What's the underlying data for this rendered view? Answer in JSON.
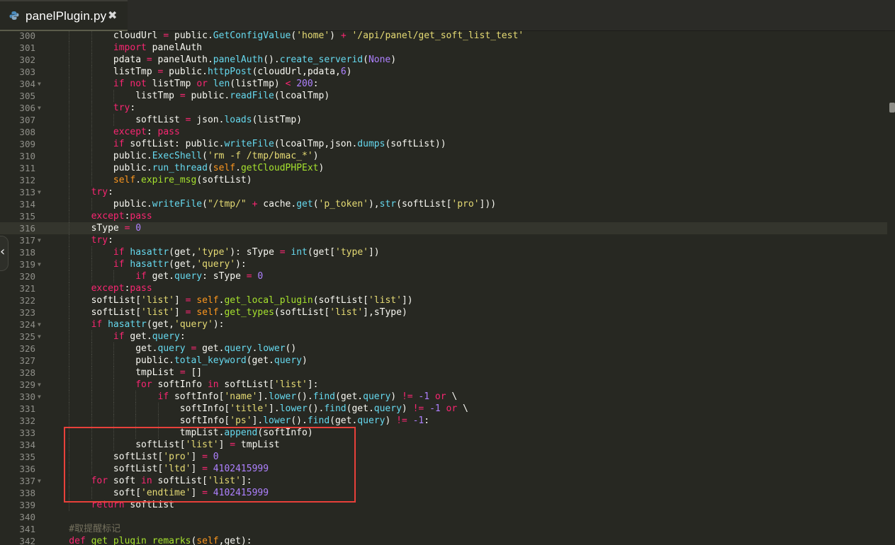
{
  "tab": {
    "title": "panelPlugin.py",
    "close_glyph": "✖",
    "icon": "python-icon"
  },
  "handle": {
    "glyph": "‹",
    "icon": "chevron-left-icon"
  },
  "colors": {
    "background": "#272822",
    "highlight_box": "#e8403a",
    "keyword": "#f92672",
    "builtin": "#66d9ef",
    "string": "#e6db74",
    "number": "#ae81ff"
  },
  "lines": [
    {
      "n": "300",
      "i": 3,
      "t": [
        [
          "",
          "cloudUrl "
        ],
        [
          "k",
          "="
        ],
        [
          "",
          " public."
        ],
        [
          "f",
          "GetConfigValue"
        ],
        [
          "",
          "("
        ],
        [
          "s",
          "'home'"
        ],
        [
          "",
          ") "
        ],
        [
          "k",
          "+"
        ],
        [
          "",
          " "
        ],
        [
          "s",
          "'/api/panel/get_soft_list_test'"
        ]
      ]
    },
    {
      "n": "301",
      "i": 3,
      "t": [
        [
          "k",
          "import"
        ],
        [
          "",
          " panelAuth"
        ]
      ]
    },
    {
      "n": "302",
      "i": 3,
      "t": [
        [
          "",
          "pdata "
        ],
        [
          "k",
          "="
        ],
        [
          "",
          " panelAuth."
        ],
        [
          "f",
          "panelAuth"
        ],
        [
          "",
          "()."
        ],
        [
          "f",
          "create_serverid"
        ],
        [
          "",
          "("
        ],
        [
          "n",
          "None"
        ],
        [
          "",
          ")"
        ]
      ]
    },
    {
      "n": "303",
      "i": 3,
      "t": [
        [
          "",
          "listTmp "
        ],
        [
          "k",
          "="
        ],
        [
          "",
          " public."
        ],
        [
          "f",
          "httpPost"
        ],
        [
          "",
          "(cloudUrl,pdata,"
        ],
        [
          "n",
          "6"
        ],
        [
          "",
          ")"
        ]
      ]
    },
    {
      "n": "304",
      "i": 3,
      "fold": true,
      "t": [
        [
          "k",
          "if"
        ],
        [
          "",
          " "
        ],
        [
          "k",
          "not"
        ],
        [
          "",
          " listTmp "
        ],
        [
          "k",
          "or"
        ],
        [
          "",
          " "
        ],
        [
          "f",
          "len"
        ],
        [
          "",
          "(listTmp) "
        ],
        [
          "k",
          "<"
        ],
        [
          "",
          " "
        ],
        [
          "n",
          "200"
        ],
        [
          "",
          ":"
        ]
      ]
    },
    {
      "n": "305",
      "i": 4,
      "t": [
        [
          "",
          "listTmp "
        ],
        [
          "k",
          "="
        ],
        [
          "",
          " public."
        ],
        [
          "f",
          "readFile"
        ],
        [
          "",
          "(lcoalTmp)"
        ]
      ]
    },
    {
      "n": "306",
      "i": 3,
      "fold": true,
      "t": [
        [
          "k",
          "try"
        ],
        [
          "",
          ":"
        ]
      ]
    },
    {
      "n": "307",
      "i": 4,
      "t": [
        [
          "",
          "softList "
        ],
        [
          "k",
          "="
        ],
        [
          "",
          " json."
        ],
        [
          "f",
          "loads"
        ],
        [
          "",
          "(listTmp)"
        ]
      ]
    },
    {
      "n": "308",
      "i": 3,
      "t": [
        [
          "k",
          "except"
        ],
        [
          "",
          ": "
        ],
        [
          "k",
          "pass"
        ]
      ]
    },
    {
      "n": "309",
      "i": 3,
      "t": [
        [
          "k",
          "if"
        ],
        [
          "",
          " softList: public."
        ],
        [
          "f",
          "writeFile"
        ],
        [
          "",
          "(lcoalTmp,json."
        ],
        [
          "f",
          "dumps"
        ],
        [
          "",
          "(softList))"
        ]
      ]
    },
    {
      "n": "310",
      "i": 3,
      "t": [
        [
          "",
          "public."
        ],
        [
          "f",
          "ExecShell"
        ],
        [
          "",
          "("
        ],
        [
          "s",
          "'rm -f /tmp/bmac_*'"
        ],
        [
          "",
          ")"
        ]
      ]
    },
    {
      "n": "311",
      "i": 3,
      "t": [
        [
          "",
          "public."
        ],
        [
          "f",
          "run_thread"
        ],
        [
          "",
          "("
        ],
        [
          "sf",
          "self"
        ],
        [
          "",
          "."
        ],
        [
          "b",
          "getCloudPHPExt"
        ],
        [
          "",
          ")"
        ]
      ]
    },
    {
      "n": "312",
      "i": 3,
      "t": [
        [
          "sf",
          "self"
        ],
        [
          "",
          "."
        ],
        [
          "b",
          "expire_msg"
        ],
        [
          "",
          "(softList)"
        ]
      ]
    },
    {
      "n": "313",
      "i": 2,
      "fold": true,
      "t": [
        [
          "k",
          "try"
        ],
        [
          "",
          ":"
        ]
      ]
    },
    {
      "n": "314",
      "i": 3,
      "t": [
        [
          "",
          "public."
        ],
        [
          "f",
          "writeFile"
        ],
        [
          "",
          "("
        ],
        [
          "s",
          "\"/tmp/\""
        ],
        [
          "k",
          " +"
        ],
        [
          "",
          " cache."
        ],
        [
          "f",
          "get"
        ],
        [
          "",
          "("
        ],
        [
          "s",
          "'p_token'"
        ],
        [
          "",
          "),"
        ],
        [
          "f",
          "str"
        ],
        [
          "",
          "(softList["
        ],
        [
          "s",
          "'pro'"
        ],
        [
          "",
          "]))"
        ]
      ]
    },
    {
      "n": "315",
      "i": 2,
      "t": [
        [
          "k",
          "except"
        ],
        [
          "",
          ":"
        ],
        [
          "k",
          "pass"
        ]
      ]
    },
    {
      "n": "316",
      "i": 2,
      "cur": true,
      "t": [
        [
          "",
          "sType "
        ],
        [
          "k",
          "="
        ],
        [
          "",
          " "
        ],
        [
          "n",
          "0"
        ]
      ]
    },
    {
      "n": "317",
      "i": 2,
      "fold": true,
      "t": [
        [
          "k",
          "try"
        ],
        [
          "",
          ":"
        ]
      ]
    },
    {
      "n": "318",
      "i": 3,
      "t": [
        [
          "k",
          "if"
        ],
        [
          "",
          " "
        ],
        [
          "f",
          "hasattr"
        ],
        [
          "",
          "(get,"
        ],
        [
          "s",
          "'type'"
        ],
        [
          "",
          "): sType "
        ],
        [
          "k",
          "="
        ],
        [
          "",
          " "
        ],
        [
          "f",
          "int"
        ],
        [
          "",
          "(get["
        ],
        [
          "s",
          "'type'"
        ],
        [
          "",
          "])"
        ]
      ]
    },
    {
      "n": "319",
      "i": 3,
      "fold": true,
      "t": [
        [
          "k",
          "if"
        ],
        [
          "",
          " "
        ],
        [
          "f",
          "hasattr"
        ],
        [
          "",
          "(get,"
        ],
        [
          "s",
          "'query'"
        ],
        [
          "",
          "):"
        ]
      ]
    },
    {
      "n": "320",
      "i": 4,
      "t": [
        [
          "k",
          "if"
        ],
        [
          "",
          " get."
        ],
        [
          "f",
          "query"
        ],
        [
          "",
          ": sType "
        ],
        [
          "k",
          "="
        ],
        [
          "",
          " "
        ],
        [
          "n",
          "0"
        ]
      ]
    },
    {
      "n": "321",
      "i": 2,
      "t": [
        [
          "k",
          "except"
        ],
        [
          "",
          ":"
        ],
        [
          "k",
          "pass"
        ]
      ]
    },
    {
      "n": "322",
      "i": 2,
      "t": [
        [
          "",
          "softList["
        ],
        [
          "s",
          "'list'"
        ],
        [
          "",
          "] "
        ],
        [
          "k",
          "="
        ],
        [
          "",
          " "
        ],
        [
          "sf",
          "self"
        ],
        [
          "",
          "."
        ],
        [
          "b",
          "get_local_plugin"
        ],
        [
          "",
          "(softList["
        ],
        [
          "s",
          "'list'"
        ],
        [
          "",
          "])"
        ]
      ]
    },
    {
      "n": "323",
      "i": 2,
      "t": [
        [
          "",
          "softList["
        ],
        [
          "s",
          "'list'"
        ],
        [
          "",
          "] "
        ],
        [
          "k",
          "="
        ],
        [
          "",
          " "
        ],
        [
          "sf",
          "self"
        ],
        [
          "",
          "."
        ],
        [
          "b",
          "get_types"
        ],
        [
          "",
          "(softList["
        ],
        [
          "s",
          "'list'"
        ],
        [
          "",
          "],sType)"
        ]
      ]
    },
    {
      "n": "324",
      "i": 2,
      "fold": true,
      "t": [
        [
          "k",
          "if"
        ],
        [
          "",
          " "
        ],
        [
          "f",
          "hasattr"
        ],
        [
          "",
          "(get,"
        ],
        [
          "s",
          "'query'"
        ],
        [
          "",
          "):"
        ]
      ]
    },
    {
      "n": "325",
      "i": 3,
      "fold": true,
      "t": [
        [
          "k",
          "if"
        ],
        [
          "",
          " get."
        ],
        [
          "f",
          "query"
        ],
        [
          "",
          ":"
        ]
      ]
    },
    {
      "n": "326",
      "i": 4,
      "t": [
        [
          "",
          "get."
        ],
        [
          "f",
          "query"
        ],
        [
          "",
          " "
        ],
        [
          "k",
          "="
        ],
        [
          "",
          " get."
        ],
        [
          "f",
          "query"
        ],
        [
          "",
          "."
        ],
        [
          "f",
          "lower"
        ],
        [
          "",
          "()"
        ]
      ]
    },
    {
      "n": "327",
      "i": 4,
      "t": [
        [
          "",
          "public."
        ],
        [
          "f",
          "total_keyword"
        ],
        [
          "",
          "(get."
        ],
        [
          "f",
          "query"
        ],
        [
          "",
          ")"
        ]
      ]
    },
    {
      "n": "328",
      "i": 4,
      "t": [
        [
          "",
          "tmpList "
        ],
        [
          "k",
          "="
        ],
        [
          "",
          " []"
        ]
      ]
    },
    {
      "n": "329",
      "i": 4,
      "fold": true,
      "t": [
        [
          "k",
          "for"
        ],
        [
          "",
          " softInfo "
        ],
        [
          "k",
          "in"
        ],
        [
          "",
          " softList["
        ],
        [
          "s",
          "'list'"
        ],
        [
          "",
          "]:"
        ]
      ]
    },
    {
      "n": "330",
      "i": 5,
      "fold": true,
      "t": [
        [
          "k",
          "if"
        ],
        [
          "",
          " softInfo["
        ],
        [
          "s",
          "'name'"
        ],
        [
          "",
          "]."
        ],
        [
          "f",
          "lower"
        ],
        [
          "",
          "()."
        ],
        [
          "f",
          "find"
        ],
        [
          "",
          "(get."
        ],
        [
          "f",
          "query"
        ],
        [
          "",
          ") "
        ],
        [
          "k",
          "!="
        ],
        [
          "",
          " "
        ],
        [
          "n",
          "-1"
        ],
        [
          "",
          " "
        ],
        [
          "k",
          "or"
        ],
        [
          "",
          " \\"
        ]
      ]
    },
    {
      "n": "331",
      "i": 6,
      "t": [
        [
          "",
          "softInfo["
        ],
        [
          "s",
          "'title'"
        ],
        [
          "",
          "]."
        ],
        [
          "f",
          "lower"
        ],
        [
          "",
          "()."
        ],
        [
          "f",
          "find"
        ],
        [
          "",
          "(get."
        ],
        [
          "f",
          "query"
        ],
        [
          "",
          ") "
        ],
        [
          "k",
          "!="
        ],
        [
          "",
          " "
        ],
        [
          "n",
          "-1"
        ],
        [
          "",
          " "
        ],
        [
          "k",
          "or"
        ],
        [
          "",
          " \\"
        ]
      ]
    },
    {
      "n": "332",
      "i": 6,
      "t": [
        [
          "",
          "softInfo["
        ],
        [
          "s",
          "'ps'"
        ],
        [
          "",
          "]."
        ],
        [
          "f",
          "lower"
        ],
        [
          "",
          "()."
        ],
        [
          "f",
          "find"
        ],
        [
          "",
          "(get."
        ],
        [
          "f",
          "query"
        ],
        [
          "",
          ") "
        ],
        [
          "k",
          "!="
        ],
        [
          "",
          " "
        ],
        [
          "n",
          "-1"
        ],
        [
          "",
          ":"
        ]
      ]
    },
    {
      "n": "333",
      "i": 6,
      "t": [
        [
          "",
          "tmpList."
        ],
        [
          "f",
          "append"
        ],
        [
          "",
          "(softInfo)"
        ]
      ]
    },
    {
      "n": "334",
      "i": 4,
      "t": [
        [
          "",
          "softList["
        ],
        [
          "s",
          "'list'"
        ],
        [
          "",
          "] "
        ],
        [
          "k",
          "="
        ],
        [
          "",
          " tmpList"
        ]
      ]
    },
    {
      "n": "335",
      "i": 3,
      "t": [
        [
          "",
          "softList["
        ],
        [
          "s",
          "'pro'"
        ],
        [
          "",
          "] "
        ],
        [
          "k",
          "="
        ],
        [
          "",
          " "
        ],
        [
          "n",
          "0"
        ]
      ]
    },
    {
      "n": "336",
      "i": 3,
      "t": [
        [
          "",
          "softList["
        ],
        [
          "s",
          "'ltd'"
        ],
        [
          "",
          "] "
        ],
        [
          "k",
          "="
        ],
        [
          "",
          " "
        ],
        [
          "n",
          "4102415999"
        ]
      ]
    },
    {
      "n": "337",
      "i": 2,
      "fold": true,
      "t": [
        [
          "k",
          "for"
        ],
        [
          "",
          " soft "
        ],
        [
          "k",
          "in"
        ],
        [
          "",
          " softList["
        ],
        [
          "s",
          "'list'"
        ],
        [
          "",
          "]:"
        ]
      ]
    },
    {
      "n": "338",
      "i": 3,
      "t": [
        [
          "",
          "soft["
        ],
        [
          "s",
          "'endtime'"
        ],
        [
          "",
          "] "
        ],
        [
          "k",
          "="
        ],
        [
          "",
          " "
        ],
        [
          "n",
          "4102415999"
        ]
      ]
    },
    {
      "n": "339",
      "i": 2,
      "t": [
        [
          "k",
          "return"
        ],
        [
          "",
          " softList"
        ]
      ]
    },
    {
      "n": "340",
      "i": 0,
      "t": []
    },
    {
      "n": "341",
      "i": 1,
      "t": [
        [
          "c",
          "#取提醒标记"
        ]
      ]
    },
    {
      "n": "342",
      "i": 1,
      "t": [
        [
          "k",
          "def"
        ],
        [
          "",
          " "
        ],
        [
          "b",
          "get_plugin_remarks"
        ],
        [
          "",
          "("
        ],
        [
          "sf",
          "self"
        ],
        [
          "",
          ",get):"
        ]
      ]
    }
  ]
}
